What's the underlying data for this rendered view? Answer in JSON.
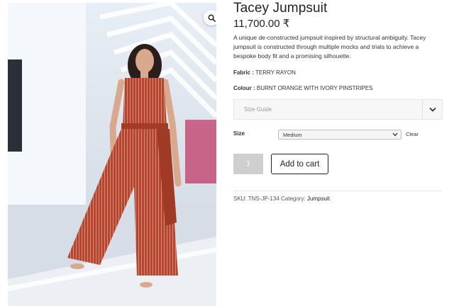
{
  "product": {
    "title": "Tacey Jumpsuit",
    "price": "11,700.00 ₹",
    "description": "A unique de-constructed jumpsuit inspired by structural ambiguity. Tacey jumpsuit is constructed through multiple mocks and trials to achieve a bespoke body fit and a promising silhouette.",
    "fabric_label": "Fabric :",
    "fabric_value": "TERRY RAYON",
    "colour_label": "Colour :",
    "colour_value": "BURNT ORANGE WITH IVORY PINSTRIPES"
  },
  "gallery": {
    "zoom_icon": "magnifier-icon"
  },
  "size_guide": {
    "label": "Size Guide",
    "toggle_icon": "chevron-down-icon"
  },
  "variation": {
    "size_label": "Size",
    "selected": "Medium",
    "clear": "Clear"
  },
  "cart": {
    "quantity": "1",
    "button_label": "Add to cart"
  },
  "meta": {
    "sku_label": "SKU:",
    "sku_value": "TNS-JP-134",
    "category_label": "Category:",
    "category_value": "Jumpsuit"
  },
  "colors": {
    "text": "#222222",
    "qty_bg": "#cfcfcf",
    "jumpsuit": "#b5452e",
    "pinstripe": "#efd9c6"
  }
}
